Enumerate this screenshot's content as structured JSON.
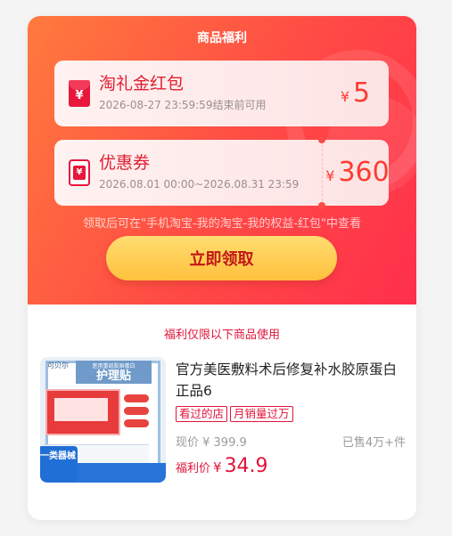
{
  "header": {
    "title": "商品福利"
  },
  "coupons": [
    {
      "name": "淘礼金红包",
      "expiry": "2026-08-27 23:59:59结束前可用",
      "currency": "¥",
      "amount": "5",
      "icon": "red-packet-icon"
    },
    {
      "name": "优惠券",
      "expiry": "2026.08.01 00:00~2026.08.31 23:59",
      "currency": "¥",
      "amount": "360",
      "icon": "coupon-ticket-icon"
    }
  ],
  "hint": "领取后可在\"手机淘宝-我的淘宝-我的权益-红包\"中查看",
  "claim_button": "立即领取",
  "scope_note": "福利仅限以下商品使用",
  "product": {
    "title": "官方美医敷料术后修复补水胶原蛋白正品6",
    "tags": [
      "看过的店",
      "月销量过万"
    ],
    "current_price": "现价 ¥ 399.9",
    "sold": "已售4万+件",
    "welfare_label": "福利价",
    "welfare_currency": "¥",
    "welfare_price": "34.9",
    "image": {
      "brand": "可贝尔",
      "head_small": "医用重组胶原蛋白",
      "head_big": "护理贴",
      "badge": "一类器械"
    }
  },
  "colors": {
    "gradient_start": "#ff7a3d",
    "gradient_end": "#ff2f4c",
    "accent_red": "#e0143a",
    "button_yellow": "#ffc13c"
  }
}
